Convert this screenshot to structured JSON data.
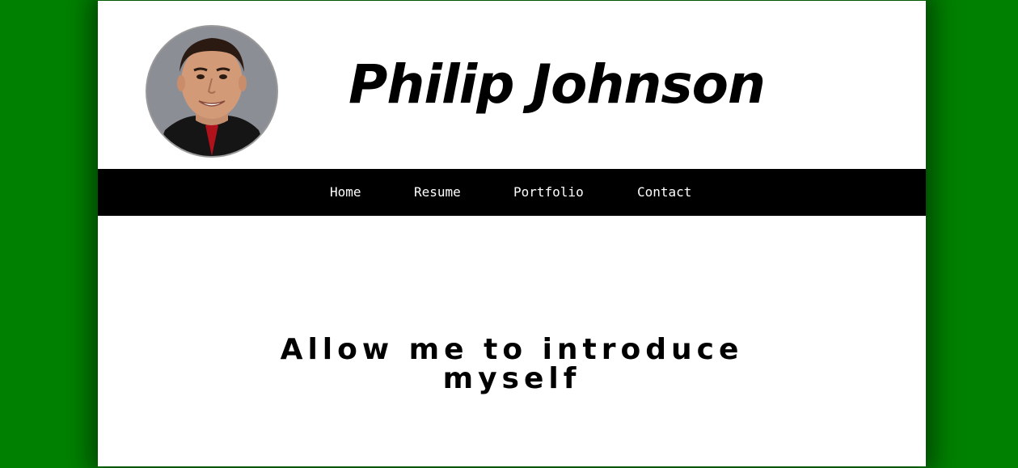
{
  "header": {
    "title": "Philip Johnson",
    "avatar_alt": "Philip Johnson"
  },
  "nav": {
    "items": [
      {
        "label": "Home"
      },
      {
        "label": "Resume"
      },
      {
        "label": "Portfolio"
      },
      {
        "label": "Contact"
      }
    ]
  },
  "main": {
    "heading_line1": "Allow me to introduce",
    "heading_line2": "myself"
  },
  "colors": {
    "background": "#008000",
    "navbar": "#000000",
    "page": "#ffffff"
  }
}
